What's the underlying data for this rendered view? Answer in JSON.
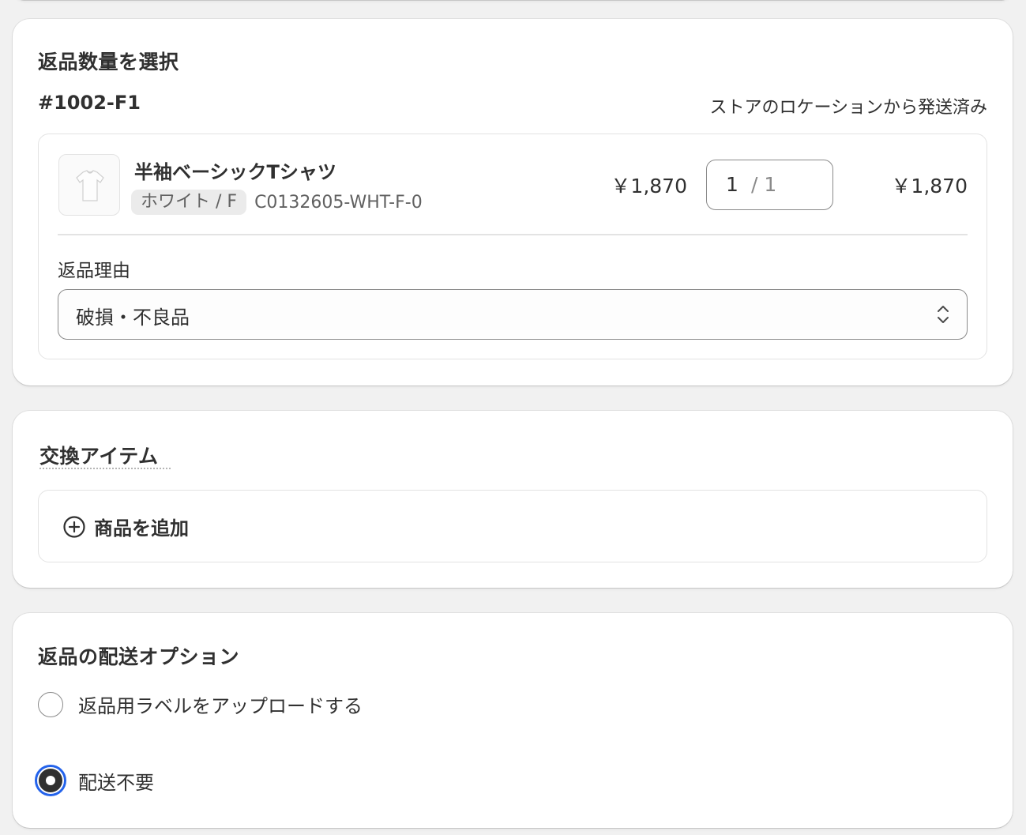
{
  "return_section": {
    "title": "返品数量を選択",
    "fulfillment_id": "#1002-F1",
    "fulfillment_status": "ストアのロケーションから発送済み",
    "item": {
      "name": "半袖ベーシックTシャツ",
      "variant": "ホワイト / F",
      "sku": "C0132605-WHT-F-0",
      "unit_price": "￥1,870",
      "quantity": "1",
      "quantity_max": "/ 1",
      "line_total": "￥1,870"
    },
    "reason_label": "返品理由",
    "reason_value": "破損・不良品"
  },
  "exchange_section": {
    "title": "交換アイテム",
    "add_product_label": "商品を追加"
  },
  "shipping_section": {
    "title": "返品の配送オプション",
    "options": [
      {
        "label": "返品用ラベルをアップロードする",
        "selected": false
      },
      {
        "label": "配送不要",
        "selected": true
      }
    ]
  },
  "colors": {
    "background": "#f1f1f1",
    "card": "#ffffff",
    "text": "#303030",
    "muted_text": "#616161",
    "radio_focus_ring": "#2463eb"
  }
}
